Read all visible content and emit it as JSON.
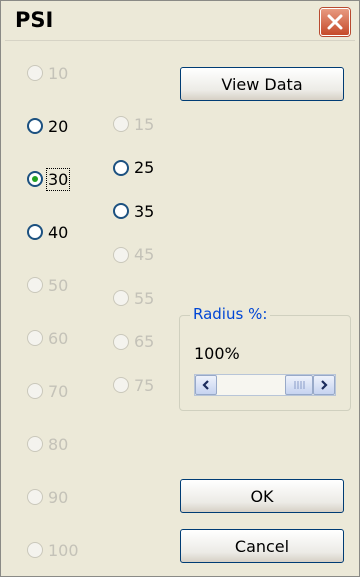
{
  "window": {
    "title": "PSI"
  },
  "radios_left": [
    {
      "label": "10",
      "enabled": false,
      "checked": false
    },
    {
      "label": "20",
      "enabled": true,
      "checked": false
    },
    {
      "label": "30",
      "enabled": true,
      "checked": true,
      "focused": true
    },
    {
      "label": "40",
      "enabled": true,
      "checked": false
    },
    {
      "label": "50",
      "enabled": false,
      "checked": false
    },
    {
      "label": "60",
      "enabled": false,
      "checked": false
    },
    {
      "label": "70",
      "enabled": false,
      "checked": false
    },
    {
      "label": "80",
      "enabled": false,
      "checked": false
    },
    {
      "label": "90",
      "enabled": false,
      "checked": false
    },
    {
      "label": "100",
      "enabled": false,
      "checked": false
    }
  ],
  "radios_right": [
    {
      "label": "15",
      "enabled": false,
      "checked": false
    },
    {
      "label": "25",
      "enabled": true,
      "checked": false
    },
    {
      "label": "35",
      "enabled": true,
      "checked": false
    },
    {
      "label": "45",
      "enabled": false,
      "checked": false
    },
    {
      "label": "55",
      "enabled": false,
      "checked": false
    },
    {
      "label": "65",
      "enabled": false,
      "checked": false
    },
    {
      "label": "75",
      "enabled": false,
      "checked": false
    }
  ],
  "buttons": {
    "view_data": "View Data",
    "ok": "OK",
    "cancel": "Cancel"
  },
  "radius": {
    "legend": "Radius %:",
    "value": "100%",
    "scroll_fraction": 1.0
  },
  "icons": {
    "close": "close-icon",
    "scroll_left": "arrow-left-icon",
    "scroll_right": "arrow-right-icon",
    "thumb_grip": "grip-icon"
  },
  "colors": {
    "face": "#ece9d8",
    "legend": "#0046d5",
    "checked_dot": "#21a121",
    "close_red": "#c54a2a"
  }
}
